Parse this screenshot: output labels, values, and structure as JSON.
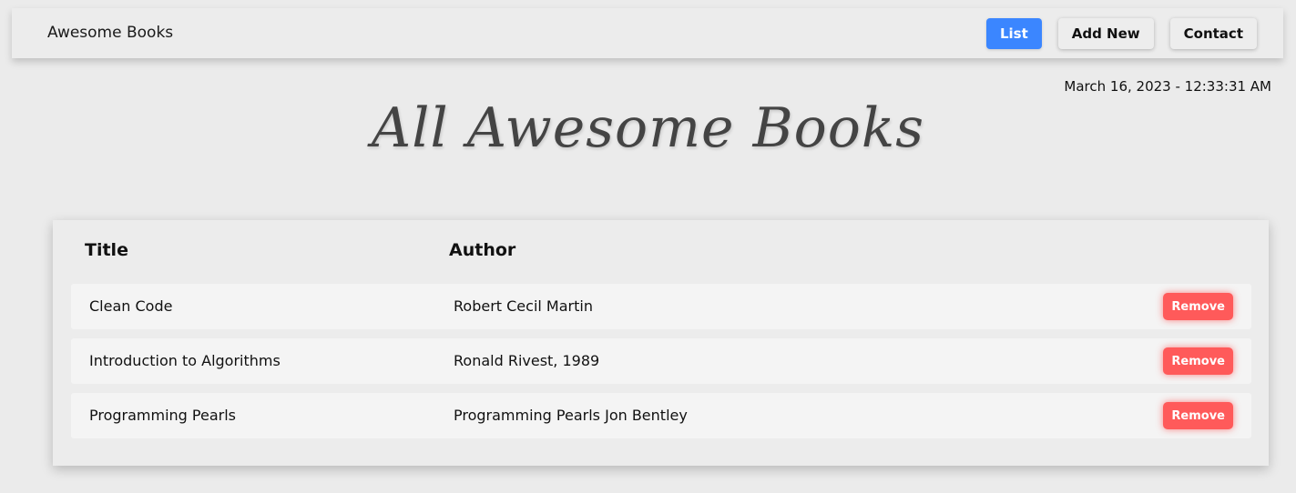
{
  "nav": {
    "brand": "Awesome Books",
    "items": [
      {
        "label": "List",
        "active": true
      },
      {
        "label": "Add New",
        "active": false
      },
      {
        "label": "Contact",
        "active": false
      }
    ]
  },
  "datetime": "March 16, 2023 - 12:33:31 AM",
  "page_title": "All Awesome Books",
  "table": {
    "headers": {
      "title": "Title",
      "author": "Author"
    },
    "rows": [
      {
        "title": "Clean Code",
        "author": "Robert Cecil Martin",
        "action": "Remove"
      },
      {
        "title": "Introduction to Algorithms",
        "author": "Ronald Rivest, 1989",
        "action": "Remove"
      },
      {
        "title": "Programming Pearls",
        "author": "Programming Pearls Jon Bentley",
        "action": "Remove"
      }
    ]
  },
  "colors": {
    "active_nav": "#3b86ff",
    "remove_button": "#ff5a5a",
    "background": "#ebebeb"
  }
}
